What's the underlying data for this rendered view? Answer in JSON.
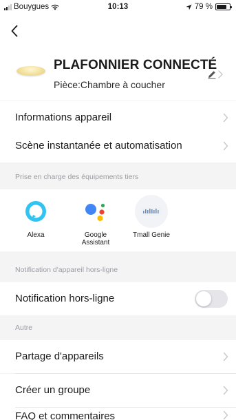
{
  "status_bar": {
    "carrier": "Bouygues",
    "time": "10:13",
    "battery_text": "79 %",
    "battery_level": 0.79
  },
  "device": {
    "name": "PLAFONNIER CONNECTÉ",
    "room": "Pièce:Chambre à coucher"
  },
  "menu_top": [
    {
      "label": "Informations appareil"
    },
    {
      "label": "Scène instantanée et automatisation"
    }
  ],
  "third_party": {
    "header": "Prise en charge des équipements tiers",
    "items": [
      {
        "name": "Alexa",
        "icon": "alexa-icon"
      },
      {
        "name_line1": "Google",
        "name_line2": "Assistant",
        "icon": "google-assistant-icon"
      },
      {
        "name": "Tmall Genie",
        "icon": "tmall-genie-icon"
      }
    ]
  },
  "offline": {
    "header": "Notification d'appareil hors-ligne",
    "label": "Notification hors-ligne",
    "enabled": false
  },
  "other": {
    "header": "Autre",
    "items": [
      {
        "label": "Partage d'appareils"
      },
      {
        "label": "Créer un groupe"
      },
      {
        "label": "FAQ et commentaires"
      }
    ]
  },
  "colors": {
    "alexa": "#31c4f3",
    "google_blue": "#4285f4",
    "google_red": "#ea4335",
    "google_yellow": "#fbbc05",
    "google_green": "#34a853",
    "chevron": "#c7c7cc",
    "toggle_off": "#e5e5ea"
  }
}
